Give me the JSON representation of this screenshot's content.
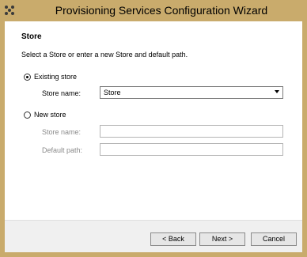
{
  "window": {
    "title": "Provisioning Services Configuration Wizard"
  },
  "page": {
    "heading": "Store",
    "description": "Select a Store or enter a new Store and default path."
  },
  "existing_store": {
    "radio_label": "Existing store",
    "selected": true,
    "store_name_label": "Store name:",
    "store_name_value": "Store"
  },
  "new_store": {
    "radio_label": "New store",
    "selected": false,
    "store_name_label": "Store name:",
    "store_name_value": "",
    "default_path_label": "Default path:",
    "default_path_value": ""
  },
  "buttons": {
    "back": "< Back",
    "next": "Next >",
    "cancel": "Cancel"
  },
  "colors": {
    "titlebar": "#c9ab6c",
    "client": "#ffffff",
    "footer": "#f0f0f0"
  },
  "icons": {
    "app": "citrix-app-icon",
    "dropdown": "chevron-down-icon"
  }
}
